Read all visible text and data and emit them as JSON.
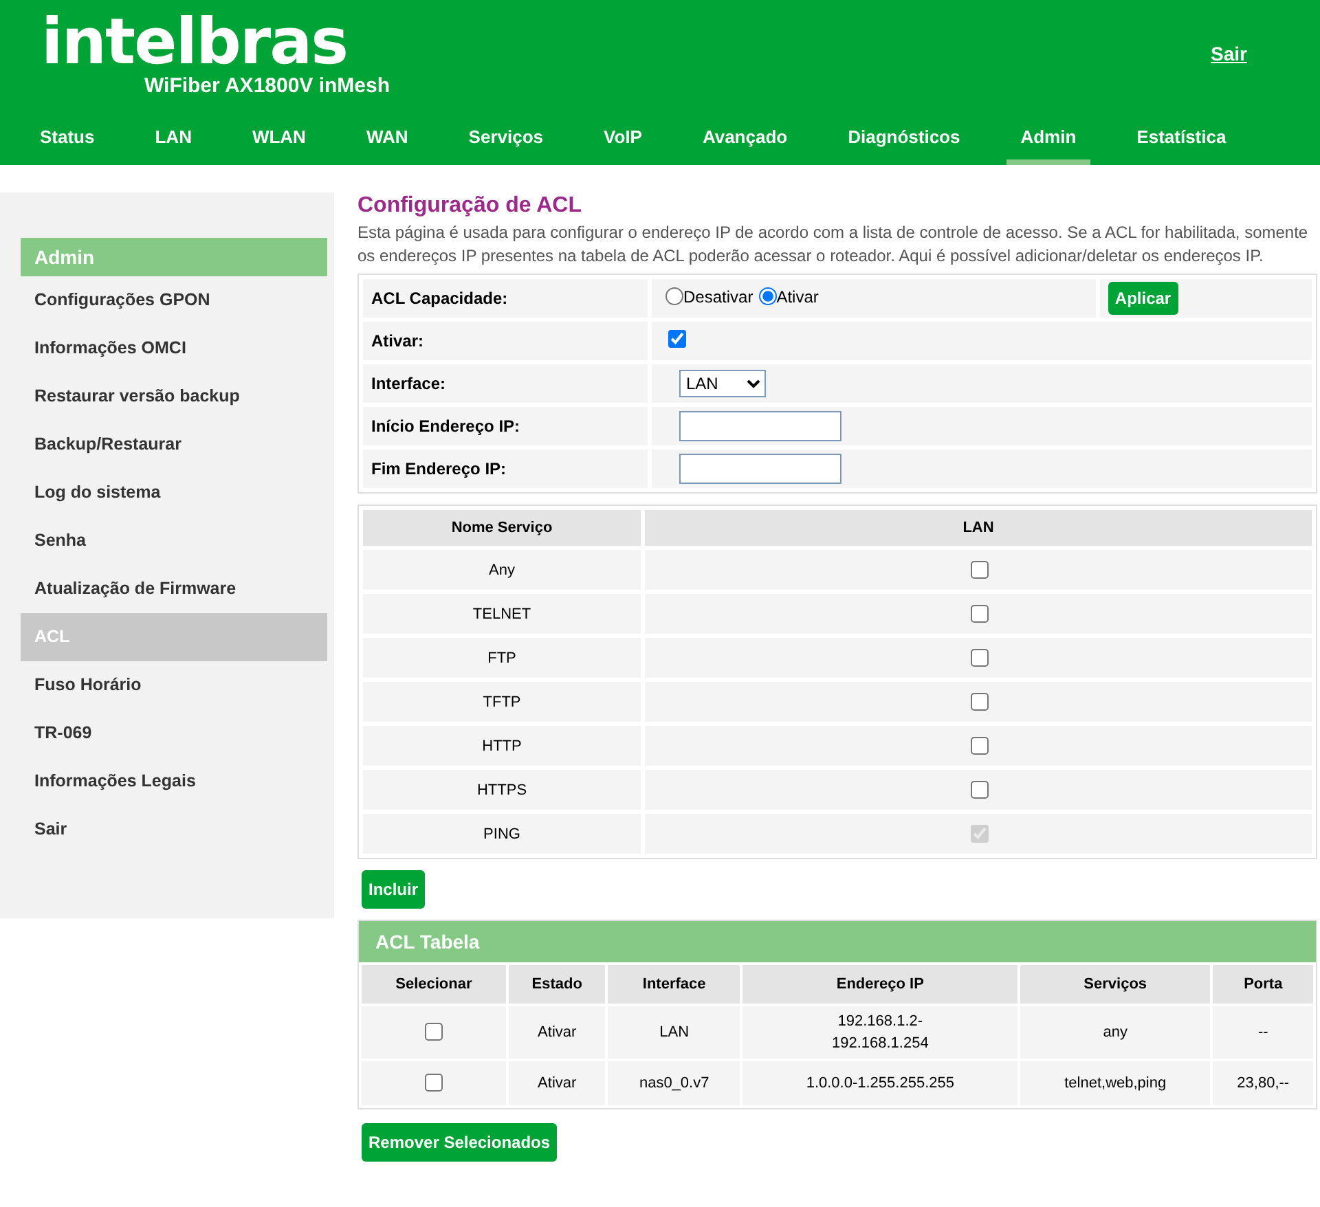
{
  "header": {
    "logo": "intelbras",
    "model": "WiFiber AX1800V inMesh",
    "logout": "Sair"
  },
  "nav": [
    {
      "label": "Status",
      "selected": false
    },
    {
      "label": "LAN",
      "selected": false
    },
    {
      "label": "WLAN",
      "selected": false
    },
    {
      "label": "WAN",
      "selected": false
    },
    {
      "label": "Serviços",
      "selected": false
    },
    {
      "label": "VoIP",
      "selected": false
    },
    {
      "label": "Avançado",
      "selected": false
    },
    {
      "label": "Diagnósticos",
      "selected": false
    },
    {
      "label": "Admin",
      "selected": true
    },
    {
      "label": "Estatística",
      "selected": false
    }
  ],
  "sidebar": {
    "title": "Admin",
    "items": [
      {
        "label": "Configurações GPON",
        "selected": false
      },
      {
        "label": "Informações OMCI",
        "selected": false
      },
      {
        "label": "Restaurar versão backup",
        "selected": false
      },
      {
        "label": "Backup/Restaurar",
        "selected": false
      },
      {
        "label": "Log do sistema",
        "selected": false
      },
      {
        "label": "Senha",
        "selected": false
      },
      {
        "label": "Atualização de Firmware",
        "selected": false
      },
      {
        "label": "ACL",
        "selected": true
      },
      {
        "label": "Fuso Horário",
        "selected": false
      },
      {
        "label": "TR-069",
        "selected": false
      },
      {
        "label": "Informações Legais",
        "selected": false
      },
      {
        "label": "Sair",
        "selected": false
      }
    ]
  },
  "page": {
    "title": "Configuração de ACL",
    "description": "Esta página é usada para configurar o endereço IP de acordo com a lista de controle de acesso. Se a ACL for habilitada, somente os endereços IP presentes na tabela de ACL poderão acessar o roteador. Aqui é possível adicionar/deletar os endereços IP."
  },
  "form": [
    {
      "kind": "radio",
      "label": "ACL Capacidade:",
      "options": [
        {
          "label": "Desativar",
          "selected": false
        },
        {
          "label": "Ativar",
          "selected": true
        }
      ],
      "button": "Aplicar"
    },
    {
      "kind": "checkbox",
      "label": "Ativar:",
      "checked": true
    },
    {
      "kind": "select",
      "label": "Interface:",
      "value": "LAN"
    },
    {
      "kind": "text",
      "label": "Início Endereço IP:"
    },
    {
      "kind": "text",
      "label": "Fim Endereço IP:"
    }
  ],
  "services": {
    "columns": [
      "Nome Serviço",
      "LAN"
    ],
    "rows": [
      {
        "name": "Any",
        "checked": false,
        "disabled": false
      },
      {
        "name": "TELNET",
        "checked": false,
        "disabled": false
      },
      {
        "name": "FTP",
        "checked": false,
        "disabled": false
      },
      {
        "name": "TFTP",
        "checked": false,
        "disabled": false
      },
      {
        "name": "HTTP",
        "checked": false,
        "disabled": false
      },
      {
        "name": "HTTPS",
        "checked": false,
        "disabled": false
      },
      {
        "name": "PING",
        "checked": true,
        "disabled": true
      }
    ]
  },
  "add_button": "Incluir",
  "acl_table": {
    "title": "ACL Tabela",
    "columns": [
      "Selecionar",
      "Estado",
      "Interface",
      "Endereço IP",
      "Serviços",
      "Porta"
    ],
    "rows": [
      {
        "cells": [
          {
            "kind": "checkbox",
            "checked": false
          },
          "Ativar",
          "LAN",
          "192.168.1.2-\n192.168.1.254",
          "any",
          "--"
        ]
      },
      {
        "cells": [
          {
            "kind": "checkbox",
            "checked": false
          },
          "Ativar",
          "nas0_0.v7",
          "1.0.0.0-1.255.255.255",
          "telnet,web,ping",
          "23,80,--"
        ]
      }
    ]
  },
  "remove_button": "Remover Selecionados"
}
